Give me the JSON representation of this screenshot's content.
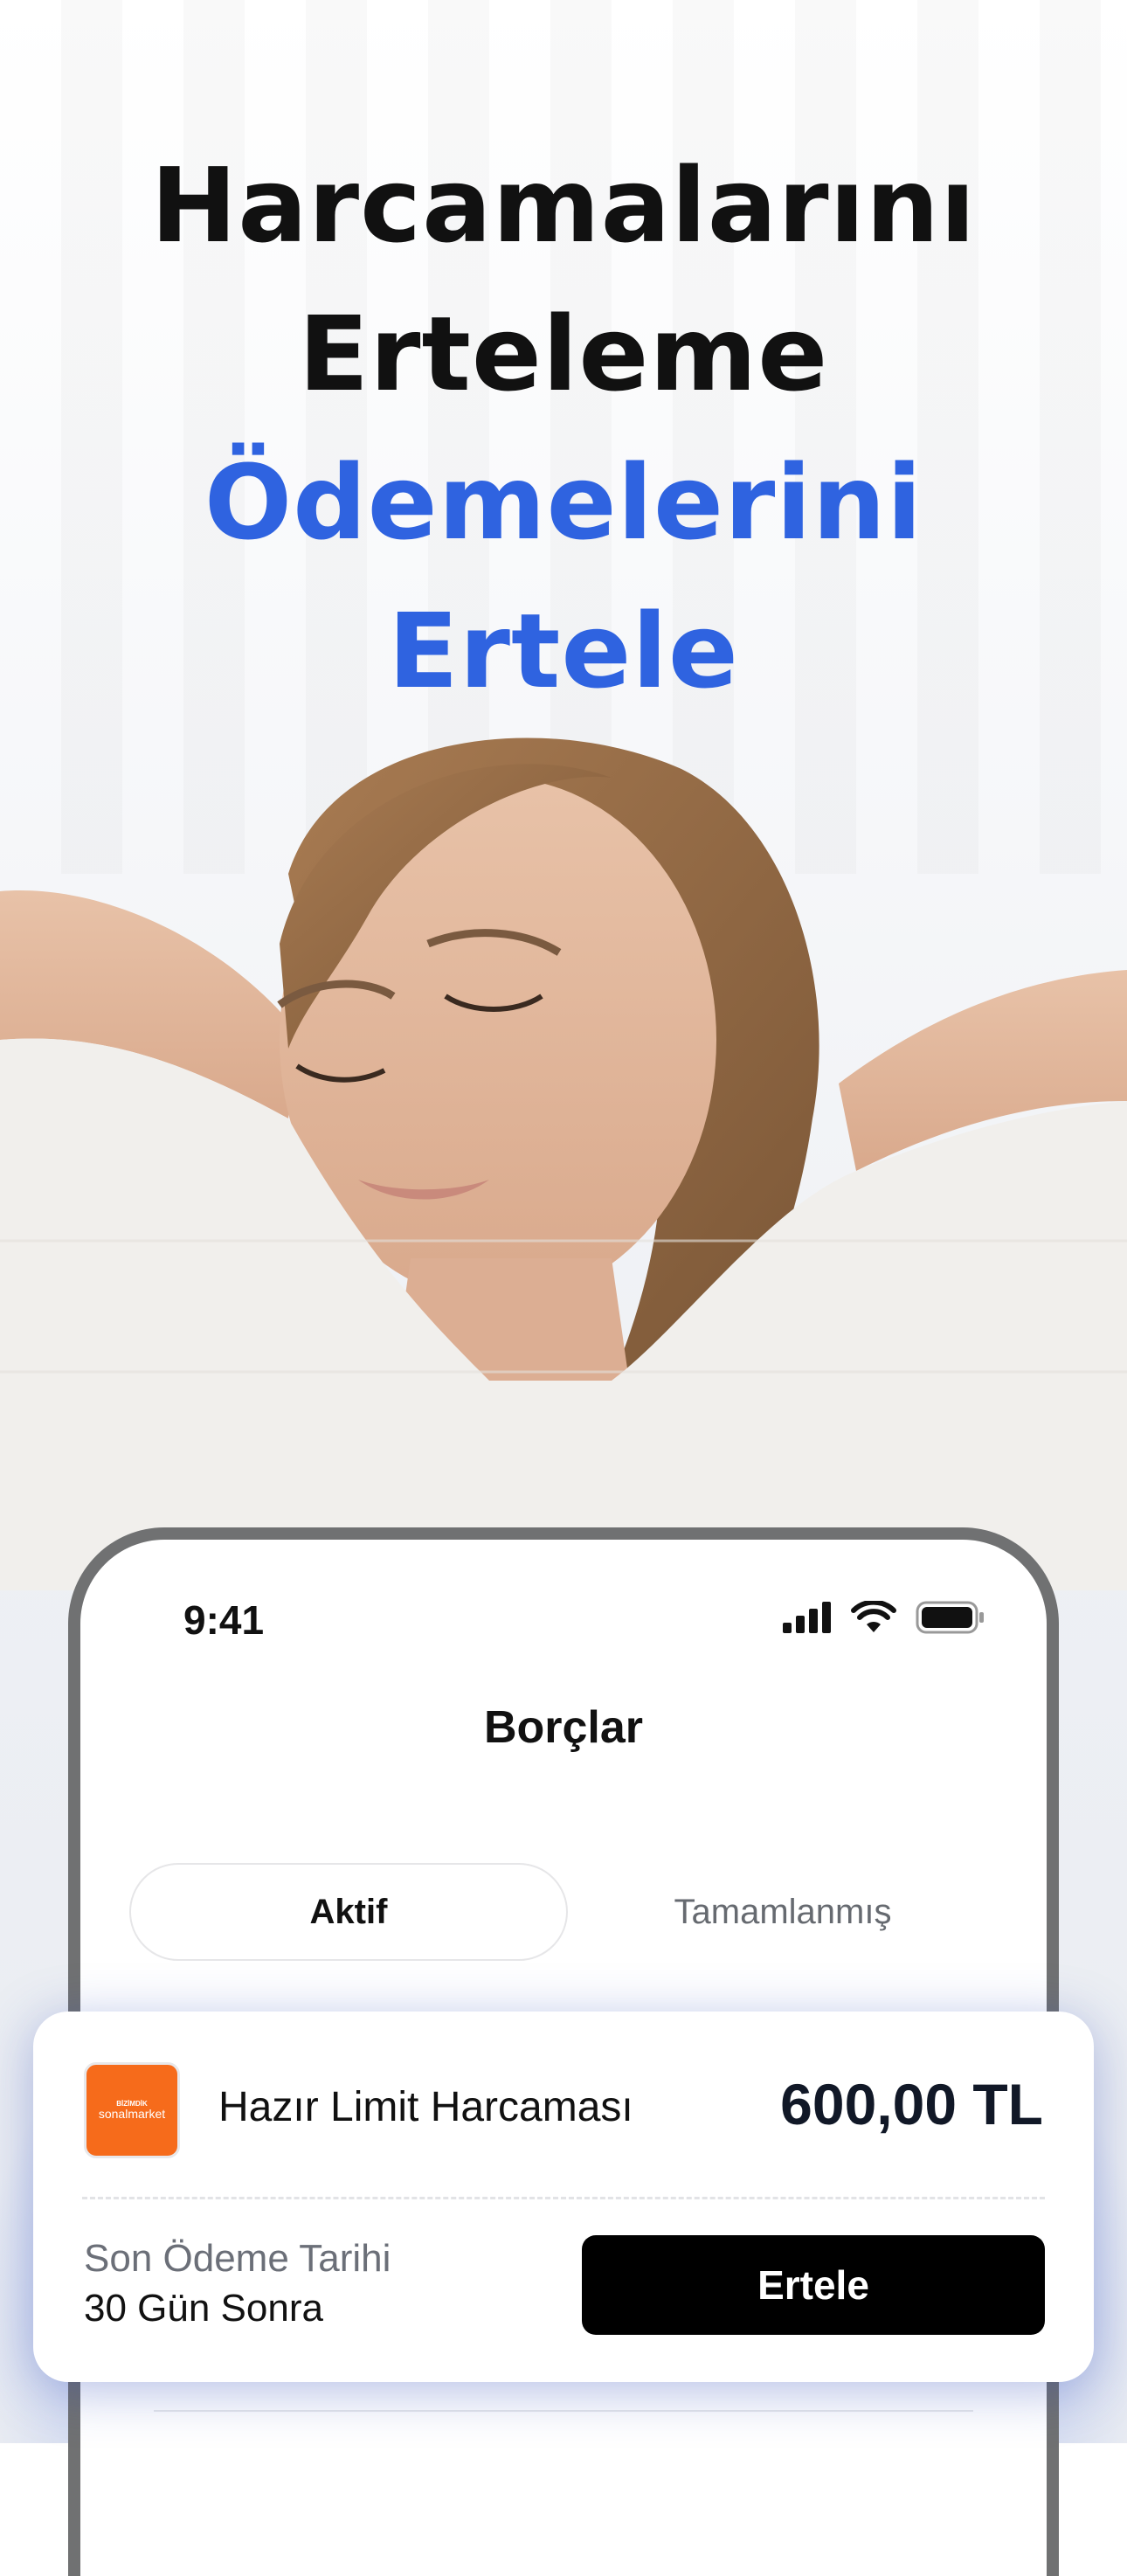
{
  "headline": {
    "line1": "Harcamalarını",
    "line2": "Erteleme",
    "line3": "Ödemelerini",
    "line4": "Ertele"
  },
  "status_bar": {
    "time": "9:41"
  },
  "screen": {
    "title": "Borçlar",
    "tabs": [
      {
        "label": "Aktif",
        "active": true
      },
      {
        "label": "Tamamlanmış",
        "active": false
      }
    ]
  },
  "debt_card": {
    "merchant_logo": {
      "line1": "BİZİMDİK",
      "line2": "sonalmarket",
      "color": "#f66b1b"
    },
    "title": "Hazır Limit Harcaması",
    "amount": "600,00 TL",
    "due_label": "Son Ödeme Tarihi",
    "due_value": "30 Gün Sonra",
    "button_label": "Ertele"
  },
  "colors": {
    "accent": "#2f63e0",
    "text_dark": "#111111",
    "button_bg": "#000000"
  }
}
